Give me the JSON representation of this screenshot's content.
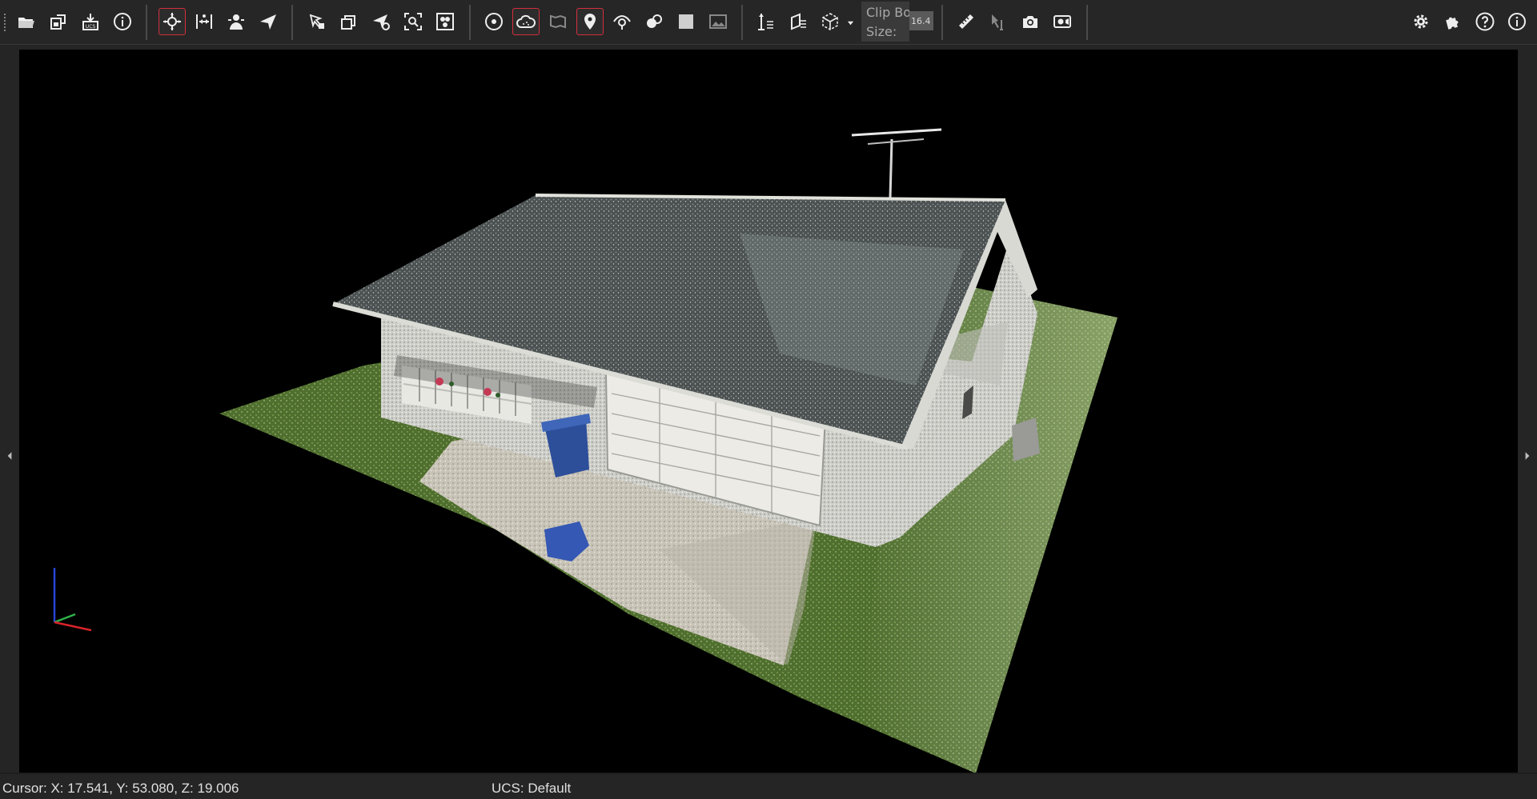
{
  "toolbar": {
    "clip_box_label_line1": "Clip Bo",
    "clip_box_label_line2": "Size:",
    "clip_box_size_value": "16.4",
    "buttons_left": [
      {
        "icon": "open-folder-icon"
      },
      {
        "icon": "save-project-icon"
      },
      {
        "icon": "import-ucs-icon"
      },
      {
        "icon": "info-icon"
      }
    ],
    "navigation_buttons": [
      {
        "icon": "orbit-navigation-icon",
        "active": true
      },
      {
        "icon": "pan-navigation-icon",
        "active": false
      },
      {
        "icon": "walk-navigation-icon",
        "active": false
      },
      {
        "icon": "fly-navigation-icon",
        "active": false
      }
    ],
    "view_buttons": [
      {
        "icon": "view-selection-icon"
      },
      {
        "icon": "view-layers-icon"
      },
      {
        "icon": "fly-to-icon"
      },
      {
        "icon": "zoom-extents-icon"
      },
      {
        "icon": "overview-icon"
      }
    ],
    "display_buttons": [
      {
        "icon": "point-size-icon",
        "active": false
      },
      {
        "icon": "point-cloud-icon",
        "active": true
      },
      {
        "icon": "panorama-icon",
        "active": false
      },
      {
        "icon": "location-pin-icon",
        "active": true
      },
      {
        "icon": "visibility-icon",
        "active": false
      },
      {
        "icon": "shading-icon",
        "active": false
      },
      {
        "icon": "background-icon",
        "active": false
      },
      {
        "icon": "image-icon",
        "active": false
      }
    ],
    "tool_buttons": [
      {
        "icon": "axis-height-icon"
      },
      {
        "icon": "clip-plane-icon"
      },
      {
        "icon": "clip-box-icon"
      }
    ],
    "measure_buttons": [
      {
        "icon": "ruler-icon"
      },
      {
        "icon": "measure-pointer-icon"
      },
      {
        "icon": "camera-snapshot-icon"
      },
      {
        "icon": "video-camera-icon"
      }
    ],
    "right_buttons": [
      {
        "icon": "settings-gear-icon"
      },
      {
        "icon": "plugin-puzzle-icon"
      },
      {
        "icon": "help-icon"
      },
      {
        "icon": "about-info-icon"
      }
    ]
  },
  "viewport": {
    "background": "#000000",
    "scene": "point-cloud-house",
    "axis_colors": {
      "x": "#d8232a",
      "y": "#2fb34a",
      "z": "#2745d6"
    }
  },
  "statusbar": {
    "cursor": "Cursor: X: 17.541, Y: 53.080, Z: 19.006",
    "ucs": "UCS: Default"
  },
  "colors": {
    "toolbar_bg": "#262626",
    "active_border": "#d32f3c",
    "icon": "#e8e8e8"
  }
}
